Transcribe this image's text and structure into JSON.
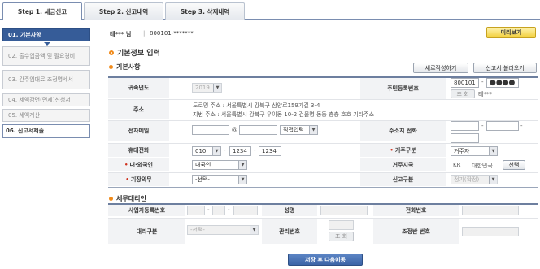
{
  "tabs": [
    "Step 1. 세금신고",
    "Step 2. 신고내역",
    "Step 3. 삭제내역"
  ],
  "sidebar": [
    {
      "label": "01. 기본사항",
      "state": "on"
    },
    {
      "label": "02. 출수입금액 및 필요경비",
      "state": "off"
    },
    {
      "label": "03. 간주임대료 조정명세서",
      "state": "off"
    },
    {
      "label": "04. 세액감면(면제)신청서",
      "state": "off"
    },
    {
      "label": "05. 세액계산",
      "state": "off"
    },
    {
      "label": "06. 신고서제출",
      "state": "sel"
    }
  ],
  "header": {
    "user": "테*** 님",
    "divider": "|",
    "id": "800101-*******",
    "preview_btn": "미리보기"
  },
  "title": "기본정보 입력",
  "basic": {
    "section": "기본사항",
    "new_btn": "새로작성하기",
    "load_btn": "신고서 불러오기",
    "year_label": "귀속년도",
    "year_value": "2019",
    "rrn_label": "주민등록번호",
    "rrn_front": "800101",
    "rrn_dash": "-",
    "rrn_back": "●●●●",
    "lookup_btn": "조 회",
    "rrn_name": "테***",
    "addr_label": "주소",
    "addr_road": "도로명 주소 :  서울특별시 강북구 삼양로159가길 3-4",
    "addr_jibun": "지번 주소 :  서울특별시 강북구 우이동 10-2 건물명 동동 층층 호호 기타주소",
    "email_label": "전자메일",
    "email_at": "@",
    "email_select": "직접입력",
    "bizphone_label": "주소지 전화",
    "mobile_label": "휴대전화",
    "mobile_1": "010",
    "mobile_2": "1234",
    "mobile_3": "1234",
    "residence_label": "거주구분",
    "residence_value": "거주자",
    "foreign_label": "내·외국인",
    "foreign_value": "내국인",
    "country_label": "거주지국",
    "country_code": "KR",
    "country_name": "대한민국",
    "country_btn": "선택",
    "bookkeep_label": "기장의무",
    "bookkeep_value": "-선택-",
    "report_label": "신고구분",
    "report_value": "정기(확정)"
  },
  "agent": {
    "section": "세무대리인",
    "bizno_label": "사업자등록번호",
    "name_label": "성명",
    "phone_label": "전화번호",
    "type_label": "대리구분",
    "type_value": "-선택-",
    "mgmt_label": "관리번호",
    "mgmt_btn": "조 회",
    "adj_label": "조정반 번호"
  },
  "submit_btn": "저장 후 다음이동"
}
